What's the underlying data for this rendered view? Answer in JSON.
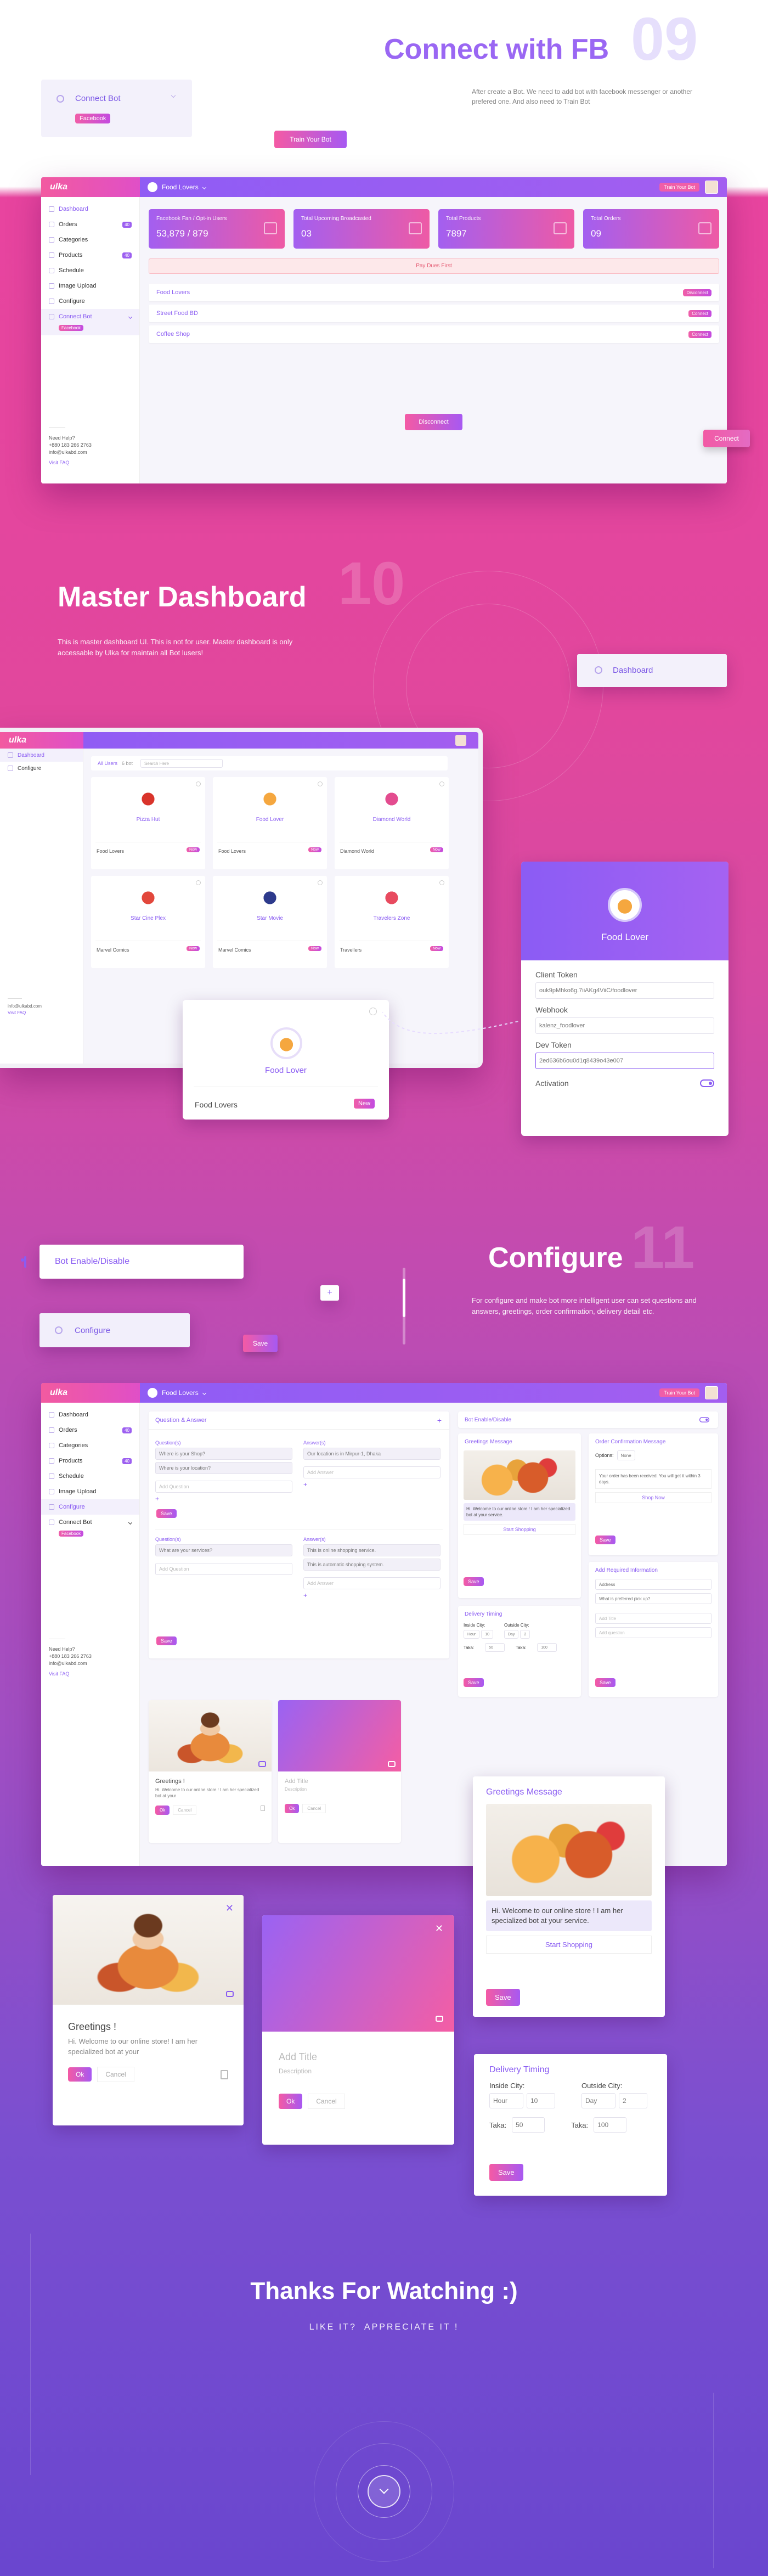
{
  "section_connect": {
    "number": "09",
    "title": "Connect with FB",
    "description": "After create a Bot. We need to add bot with facebook messenger or another prefered one. And also need to Train Bot",
    "connect_bot_label": "Connect Bot",
    "facebook_label": "Facebook",
    "train_button": "Train Your Bot",
    "connect_button": "Connect"
  },
  "dashboard1": {
    "logo": "ulka",
    "bot_select": "Food Lovers",
    "top_button": "Train Your Bot",
    "sidebar": [
      {
        "label": "Dashboard"
      },
      {
        "label": "Orders",
        "badge": "40"
      },
      {
        "label": "Categories"
      },
      {
        "label": "Products",
        "badge": "40"
      },
      {
        "label": "Schedule"
      },
      {
        "label": "Image Upload"
      },
      {
        "label": "Configure"
      },
      {
        "label": "Connect Bot"
      }
    ],
    "sidebar_sub": "Facebook",
    "help_title": "Need Help?",
    "help_phone": "+880 183 266 2763",
    "help_email": "info@ulkabd.com",
    "help_link": "Visit FAQ",
    "stats": [
      {
        "label": "Facebook Fan / Opt-in Users",
        "value": "53,879 / 879"
      },
      {
        "label": "Total Upcoming Broadcasted",
        "value": "03"
      },
      {
        "label": "Total Products",
        "value": "7897"
      },
      {
        "label": "Total Orders",
        "value": "09"
      }
    ],
    "pay_notice": "Pay Dues First",
    "pages": [
      {
        "name": "Food Lovers",
        "action": "Disconnect"
      },
      {
        "name": "Street Food BD",
        "action": "Connect"
      },
      {
        "name": "Coffee Shop",
        "action": "Connect"
      }
    ],
    "disconnect_button": "Disconnect"
  },
  "section_master": {
    "number": "10",
    "title": "Master Dashboard",
    "description": "This is master dashboard UI. This is not for user. Master dashboard is only accessable by Ulka for maintain all Bot lusers!",
    "chip": "Dashboard"
  },
  "dashboard2": {
    "sidebar": [
      "Dashboard",
      "Configure"
    ],
    "filter_all": "All Users",
    "filter_count": "6 bot",
    "search_placeholder": "Search Here",
    "bots": [
      {
        "name": "Pizza Hut",
        "owner": "Food Lovers",
        "tag": "Now"
      },
      {
        "name": "Food Lover",
        "owner": "Food Lovers",
        "tag": "Now"
      },
      {
        "name": "Diamond World",
        "owner": "Diamond World",
        "tag": "Now"
      },
      {
        "name": "Star Cine Plex",
        "owner": "Marvel Comics",
        "tag": "Now"
      },
      {
        "name": "Star Movie",
        "owner": "Marvel Comics",
        "tag": "Now"
      },
      {
        "name": "Travelers Zone",
        "owner": "Travellers",
        "tag": "Now"
      }
    ],
    "footer_email": "info@ulkabd.com",
    "footer_link": "Visit FAQ",
    "popup": {
      "name": "Food Lover",
      "owner": "Food Lovers",
      "tag": "New"
    },
    "detail": {
      "name": "Food Lover",
      "client_token_label": "Client Token",
      "client_token": "ouk9pMhko6g.7iiAKg4ViiC/foodlover",
      "webhook_label": "Webhook",
      "webhook": "kalenz_foodlover",
      "dev_token_label": "Dev Token",
      "dev_token": "2ed636b6ou0d1q8439o43e007",
      "activation_label": "Activation"
    }
  },
  "section_configure": {
    "number": "11",
    "title": "Configure",
    "description": "For configure and make bot more intelligent user can set questions and answers, greetings, order confirmation, delivery detail etc.",
    "bot_toggle_label": "Bot Enable/Disable",
    "configure_chip": "Configure",
    "save_button": "Save",
    "plus": "+"
  },
  "dashboard3": {
    "bot_select": "Food Lovers",
    "top_button": "Train Your Bot",
    "qa_header": "Question & Answer",
    "questions_label": "Question(s)",
    "answers_label": "Answer(s)",
    "q1": [
      "Where is your Shop?",
      "Where is your location?",
      "Add Question"
    ],
    "a1": [
      "Our location is in Mirpur-1, Dhaka",
      "Add Answer"
    ],
    "q2": [
      "What are your services?",
      "Add Question"
    ],
    "a2": [
      "This is online shopping service.",
      "This is automatic shopping system.",
      "Add Answer"
    ],
    "save": "Save",
    "bot_enable": "Bot Enable/Disable",
    "greetings_title": "Greetings Message",
    "greet_text": "Hi. Welcome to our online store ! I am her specialized bot at your service.",
    "start_shopping": "Start Shopping",
    "order_conf_title": "Order Confirmation Message",
    "options_label": "Options:",
    "options_value": "None",
    "order_text": "Your order has been received. You will get it within 3 days.",
    "shop_now": "Shop Now",
    "delivery_title": "Delivery Timing",
    "inside_city": "Inside City:",
    "outside_city": "Outside City:",
    "hour": "Hour",
    "day": "Day",
    "hour_val": "10",
    "day_val": "2",
    "taka": "Taka:",
    "taka_in": "50",
    "taka_out": "100",
    "req_info_title": "Add Required Information",
    "req_fields": [
      "Address",
      "What is preferred pick up?",
      "Add Title",
      "Add question"
    ],
    "greet_card_title": "Greetings !",
    "greet_card_text": "Hi. Welcome to our online store ! I am her specialized bot at your",
    "ok": "Ok",
    "cancel": "Cancel",
    "add_title": "Add Title",
    "description": "Description"
  },
  "floating_greetings": {
    "title": "Greetings Message",
    "text": "Hi. Welcome to our online store ! I am her specialized bot at your service.",
    "start_shopping": "Start Shopping",
    "save": "Save"
  },
  "floating_greet_card": {
    "title": "Greetings !",
    "text": "Hi. Welcome to our online store! I am her specialized bot at your",
    "ok": "Ok",
    "cancel": "Cancel"
  },
  "floating_add_card": {
    "title": "Add Title",
    "description": "Description",
    "ok": "Ok",
    "cancel": "Cancel"
  },
  "floating_delivery": {
    "title": "Delivery Timing",
    "inside": "Inside City:",
    "outside": "Outside City:",
    "hour": "Hour",
    "hour_val": "10",
    "day": "Day",
    "day_val": "2",
    "taka": "Taka:",
    "taka_in": "50",
    "taka_out": "100",
    "save": "Save"
  },
  "outro": {
    "title": "Thanks For Watching :)",
    "subtitle": "LIKE IT?  APPRECIATE IT !"
  },
  "colors": {
    "purple": "#8a5cf2",
    "pink": "#f05ea8",
    "bg_pink": "#e1479d",
    "bg_purple": "#6a46cf"
  }
}
